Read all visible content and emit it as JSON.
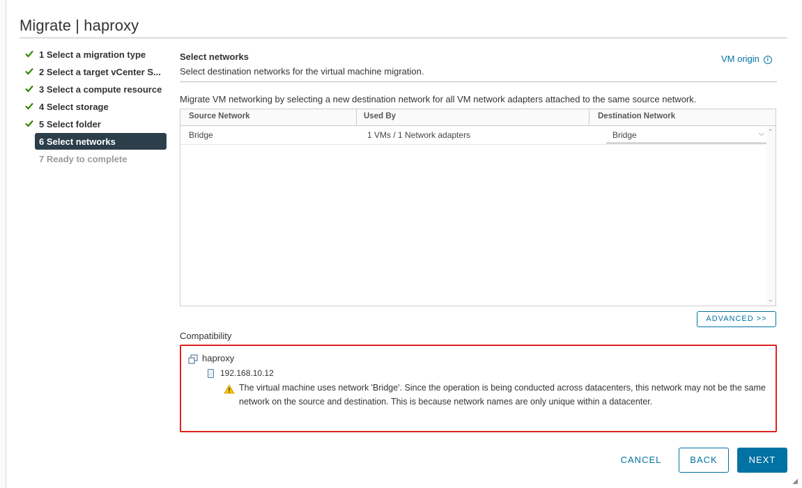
{
  "dialog": {
    "title": "Migrate | haproxy"
  },
  "steps": [
    {
      "label": "1 Select a migration type",
      "state": "done"
    },
    {
      "label": "2 Select a target vCenter S...",
      "state": "done"
    },
    {
      "label": "3 Select a compute resource",
      "state": "done"
    },
    {
      "label": "4 Select storage",
      "state": "done"
    },
    {
      "label": "5 Select folder",
      "state": "done"
    },
    {
      "label": "6 Select networks",
      "state": "active"
    },
    {
      "label": "7 Ready to complete",
      "state": "disabled"
    }
  ],
  "main": {
    "title": "Select networks",
    "subtitle": "Select destination networks for the virtual machine migration.",
    "vm_origin_link": "VM origin",
    "description": "Migrate VM networking by selecting a new destination network for all VM network adapters attached to the same source network."
  },
  "grid": {
    "columns": [
      "Source Network",
      "Used By",
      "Destination Network"
    ],
    "rows": [
      {
        "source": "Bridge",
        "used_by": "1 VMs / 1 Network adapters",
        "destination": "Bridge"
      }
    ]
  },
  "advanced_button": "ADVANCED >>",
  "compatibility": {
    "label": "Compatibility",
    "vm_name": "haproxy",
    "host": "192.168.10.12",
    "message": "The virtual machine uses network 'Bridge'.  Since the operation is being conducted across datacenters, this network may not be the same network on the source and destination.  This is because network names are only unique within a datacenter."
  },
  "footer": {
    "cancel": "CANCEL",
    "back": "BACK",
    "next": "NEXT"
  },
  "colors": {
    "accent": "#0072a3",
    "active_step": "#2b3e4a",
    "check": "#318700",
    "highlight_border": "#e02020",
    "warning": "#f5c400"
  }
}
